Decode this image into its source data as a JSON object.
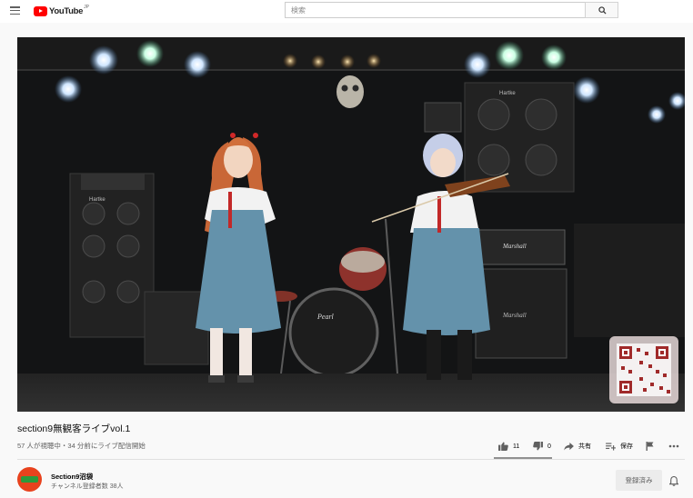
{
  "header": {
    "logo_text": "YouTube",
    "region": "JP",
    "search_placeholder": "検索"
  },
  "video": {
    "title": "section9無観客ライブvol.1",
    "meta": "57 人が視聴中・34 分前にライブ配信開始",
    "stage_labels": {
      "amp_brand_left": "Hartke",
      "amp_brand_right": "Hartke",
      "marshall": "Marshall",
      "marshall_bottom": "Marshall",
      "drum_brand": "Pearl"
    }
  },
  "actions": {
    "like_count": "11",
    "dislike_count": "0",
    "share_label": "共有",
    "save_label": "保存"
  },
  "channel": {
    "name": "Section9沼袋",
    "subscribers": "チャンネル登録者数 38人",
    "subscribe_label": "登録済み"
  },
  "colors": {
    "brand_red": "#ff0000",
    "avatar_bg": "#e8421d"
  }
}
